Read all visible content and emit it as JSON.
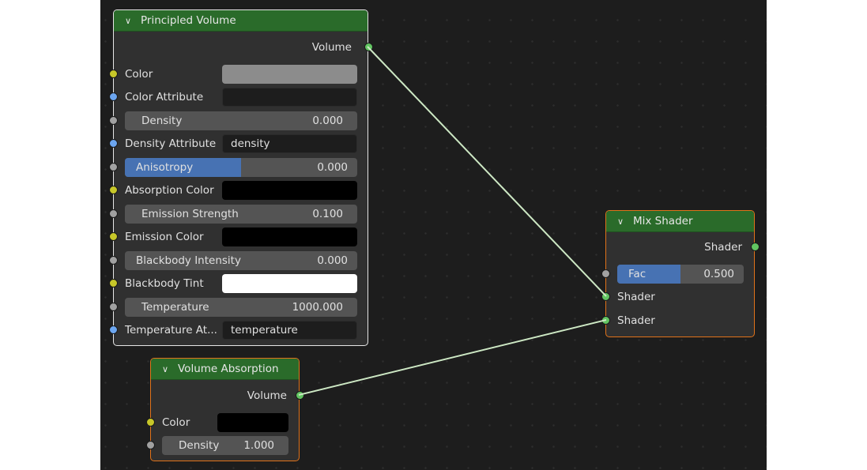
{
  "nodes": {
    "principled_volume": {
      "title": "Principled Volume",
      "output": "Volume",
      "inputs": [
        {
          "label": "Color",
          "socket": "color",
          "widget": "color",
          "color": "#8c8c8c"
        },
        {
          "label": "Color Attribute",
          "socket": "string",
          "widget": "text",
          "value": ""
        },
        {
          "label": "Density",
          "socket": "float",
          "widget": "slider",
          "value": "0.000"
        },
        {
          "label": "Density Attribute",
          "socket": "string",
          "widget": "text",
          "value": "density"
        },
        {
          "label": "Anisotropy",
          "socket": "float",
          "widget": "factor",
          "value": "0.000",
          "fill_fraction": 0.5
        },
        {
          "label": "Absorption Color",
          "socket": "color",
          "widget": "color",
          "color": "#000000"
        },
        {
          "label": "Emission Strength",
          "socket": "float",
          "widget": "slider",
          "value": "0.100"
        },
        {
          "label": "Emission Color",
          "socket": "color",
          "widget": "color",
          "color": "#000000"
        },
        {
          "label": "Blackbody Intensity",
          "socket": "float",
          "widget": "factor",
          "value": "0.000",
          "fill_fraction": 0
        },
        {
          "label": "Blackbody Tint",
          "socket": "color",
          "widget": "color",
          "color": "#ffffff"
        },
        {
          "label": "Temperature",
          "socket": "float",
          "widget": "slider",
          "value": "1000.000"
        },
        {
          "label": "Temperature At...",
          "socket": "string",
          "widget": "text",
          "value": "temperature"
        }
      ]
    },
    "volume_absorption": {
      "title": "Volume Absorption",
      "output": "Volume",
      "inputs": [
        {
          "label": "Color",
          "socket": "color",
          "widget": "color",
          "color": "#000000"
        },
        {
          "label": "Density",
          "socket": "float",
          "widget": "slider",
          "value": "1.000"
        }
      ]
    },
    "mix_shader": {
      "title": "Mix Shader",
      "output": "Shader",
      "inputs": [
        {
          "label": "Fac",
          "socket": "float",
          "widget": "factor",
          "value": "0.500",
          "fill_fraction": 0.5
        },
        {
          "label": "Shader",
          "socket": "shader"
        },
        {
          "label": "Shader",
          "socket": "shader"
        }
      ]
    }
  },
  "links": [
    {
      "from": "principled_volume.Volume",
      "to": "mix_shader.Shader1"
    },
    {
      "from": "volume_absorption.Volume",
      "to": "mix_shader.Shader2"
    }
  ],
  "colors": {
    "header": "#2a6b2a",
    "node_body": "#303030",
    "link": "#cde8c4",
    "selected_active": "#e6e6e6",
    "selected": "#e0721a",
    "factor_fill": "#4772b3"
  }
}
